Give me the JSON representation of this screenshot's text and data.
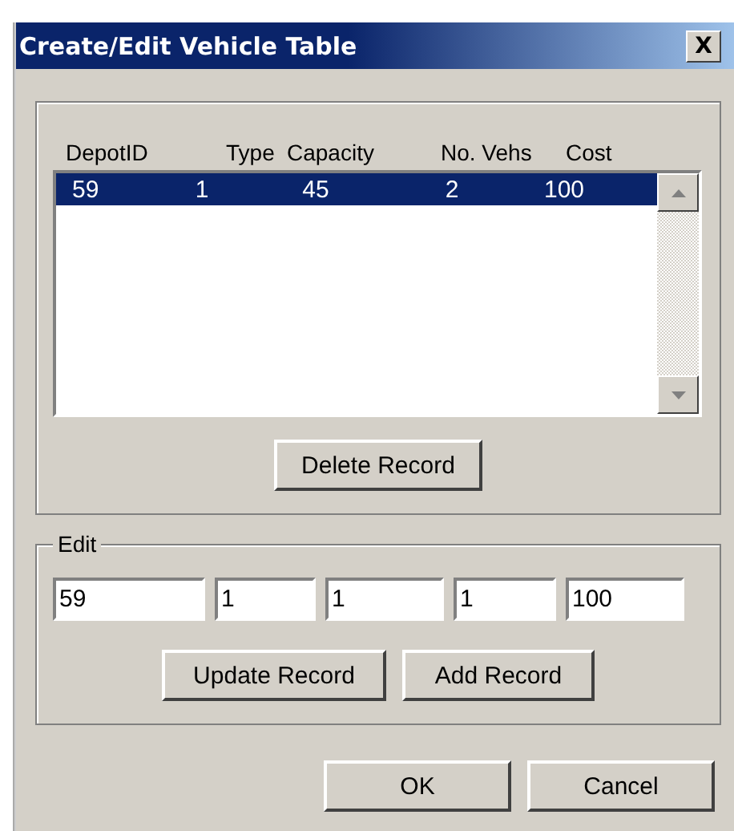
{
  "window": {
    "title": "Create/Edit Vehicle Table",
    "close": "X"
  },
  "table": {
    "columns": [
      "DepotID",
      "Type",
      "Capacity",
      "No. Vehs",
      "Cost"
    ],
    "rows": [
      {
        "cells": [
          "59",
          "1",
          "45",
          "2",
          "100"
        ],
        "selected": true
      }
    ]
  },
  "delete_button": "Delete Record",
  "edit": {
    "legend": "Edit",
    "fields": [
      "59",
      "1",
      "1",
      "1",
      "100"
    ],
    "buttons": [
      "Update Record",
      "Add Record"
    ]
  },
  "buttons": [
    "OK",
    "Cancel"
  ]
}
